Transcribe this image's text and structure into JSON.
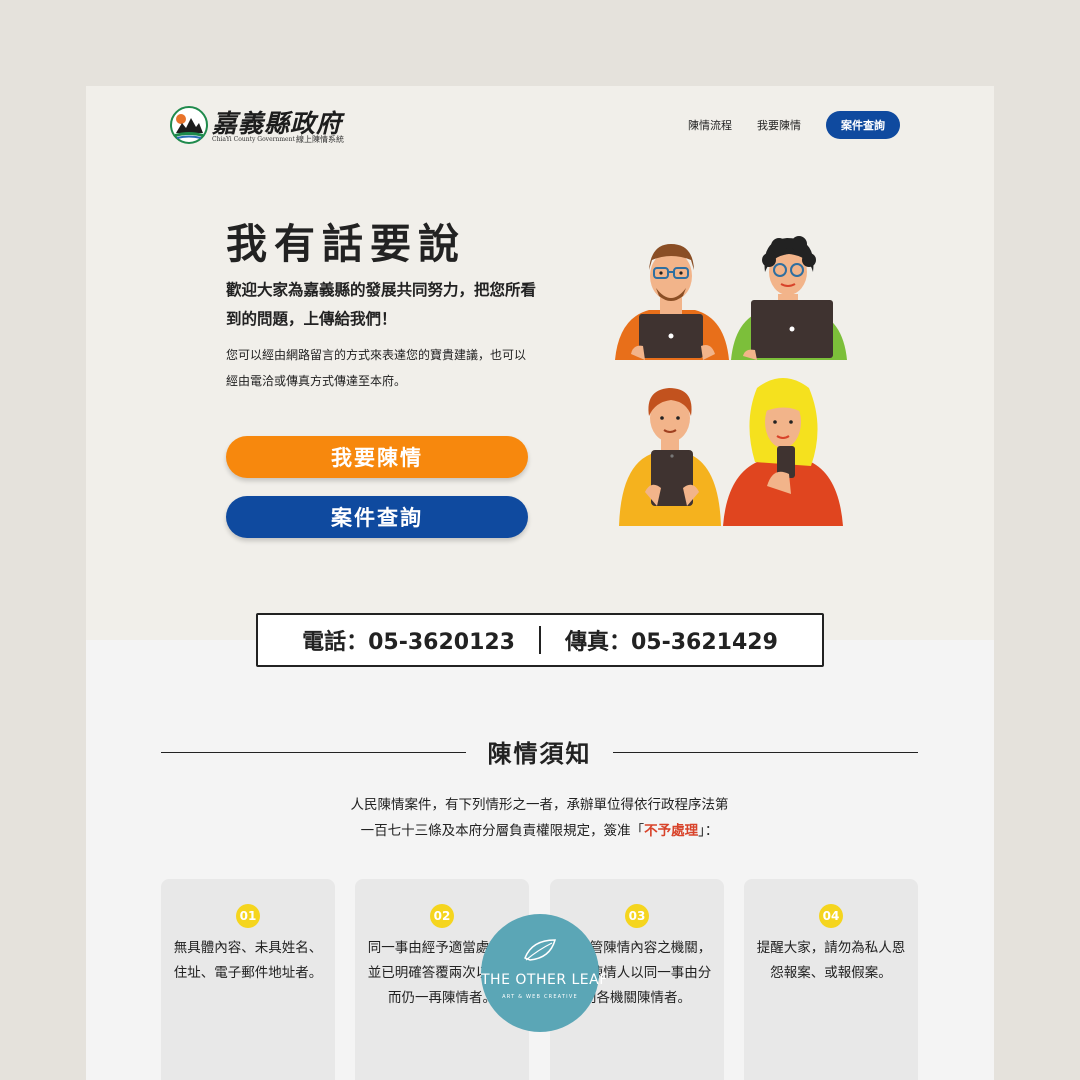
{
  "header": {
    "logo_title": "嘉義縣政府",
    "logo_sub_en": "ChiaYi County Government",
    "logo_sub_zh": "線上陳情系統",
    "nav": [
      "陳情流程",
      "我要陳情"
    ],
    "nav_button": "案件查詢"
  },
  "hero": {
    "title": "我有話要說",
    "lead": "歡迎大家為嘉義縣的發展共同努力，把您所看到的問題，上傳給我們！",
    "desc": "您可以經由網路留言的方式來表達您的寶貴建議，也可以經由電洽或傳真方式傳達至本府。",
    "btn_petition": "我要陳情",
    "btn_query": "案件查詢"
  },
  "contact": {
    "phone": "電話：05-3620123",
    "fax": "傳真：05-3621429"
  },
  "notice": {
    "title": "陳情須知",
    "intro_1": "人民陳情案件，有下列情形之一者，承辦單位得依行政程序法第",
    "intro_2": "一百七十三條及本府分層負責權限規定，簽准「",
    "intro_highlight": "不予處理",
    "intro_3": "」：",
    "items": [
      {
        "num": "01",
        "text": "無具體內容、未具姓名、住址、電子郵件地址者。"
      },
      {
        "num": "02",
        "text": "同一事由經予適當處理，並已明確答覆兩次以上，而仍一再陳情者。"
      },
      {
        "num": "03",
        "text": "非主管陳情內容之機關，接獲陳情人以同一事由分向各機關陳情者。"
      },
      {
        "num": "04",
        "text": "提醒大家，請勿為私人恩怨報案、或報假案。"
      }
    ]
  },
  "watermark": {
    "name": "THE OTHER LEAF",
    "sub": "ART & WEB CREATIVE"
  },
  "colors": {
    "orange": "#f7880d",
    "blue": "#0f4a9f",
    "yellow": "#f5d51e",
    "highlight": "#d8432a",
    "watermark": "#5ba6b6"
  }
}
